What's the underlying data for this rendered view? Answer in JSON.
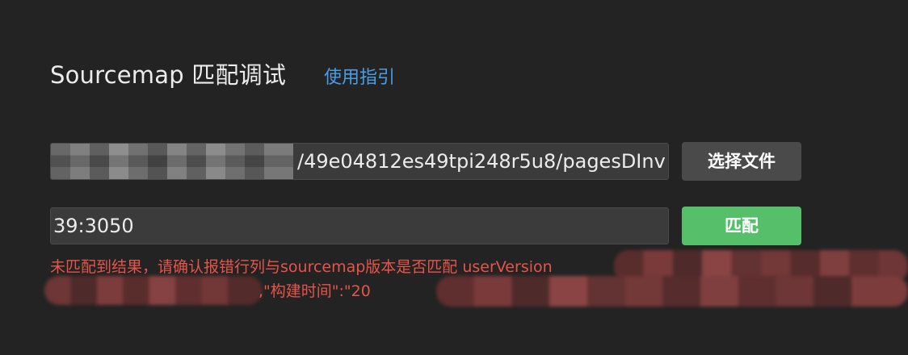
{
  "header": {
    "title": "Sourcemap 匹配调试",
    "guide_link": "使用指引"
  },
  "form": {
    "file_path_value": "/49e04812es49tpi248r5u8/pagesDInv",
    "choose_file_label": "选择文件",
    "location_value": "39:3050",
    "match_label": "匹配"
  },
  "result": {
    "error_line1": "未匹配到结果，请确认报错行列与sourcemap版本是否匹配 userVersion",
    "error_line2_visible": ",\"构建时间\":\"20"
  },
  "colors": {
    "background": "#232323",
    "link": "#4a9ee6",
    "match_button": "#56bf6a",
    "error_text": "#e6544a"
  }
}
